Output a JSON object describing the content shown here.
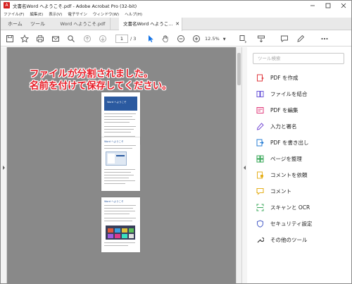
{
  "window": {
    "title": "文書名Word へようこそ.pdf - Adobe Acrobat Pro (32-bit)"
  },
  "menu": [
    "ファイル(F)",
    "編集(E)",
    "表示(V)",
    "電子サイン",
    "ウィンドウ(W)",
    "ヘルプ(H)"
  ],
  "tabs": {
    "home": "ホーム",
    "tools": "ツール"
  },
  "doc_tabs": [
    {
      "label": "Word へようこそ.pdf",
      "active": false
    },
    {
      "label": "文書名Word へようこ...",
      "active": true
    }
  ],
  "toolbar": {
    "page_current": "1",
    "page_total": "/ 3",
    "zoom": "12.5%"
  },
  "annotation": {
    "line1": "ファイルが分割されました。",
    "line2": "名前を付けて保存してください。",
    "color": "#e8202a"
  },
  "right_pane": {
    "search_placeholder": "ツール検索",
    "tools": [
      {
        "label": "PDF を作成",
        "icon": "create-pdf-icon",
        "color": "#e0393e"
      },
      {
        "label": "ファイルを結合",
        "icon": "combine-files-icon",
        "color": "#6a55d8"
      },
      {
        "label": "PDF を編集",
        "icon": "edit-pdf-icon",
        "color": "#e0397a"
      },
      {
        "label": "入力と署名",
        "icon": "fill-sign-icon",
        "color": "#7b52d6"
      },
      {
        "label": "PDF を書き出し",
        "icon": "export-pdf-icon",
        "color": "#2a7fd6"
      },
      {
        "label": "ページを整理",
        "icon": "organize-pages-icon",
        "color": "#3aa85a"
      },
      {
        "label": "コメントを依頼",
        "icon": "request-comment-icon",
        "color": "#e5b01f"
      },
      {
        "label": "コメント",
        "icon": "comment-icon",
        "color": "#e5b01f"
      },
      {
        "label": "スキャンと OCR",
        "icon": "scan-ocr-icon",
        "color": "#3aa85a"
      },
      {
        "label": "セキュリティ設定",
        "icon": "shield-icon",
        "color": "#4a5fc8"
      },
      {
        "label": "その他のツール",
        "icon": "more-tools-icon",
        "color": "#333333"
      }
    ]
  },
  "pages": {
    "p1_banner": "Word へようこそ",
    "p2_banner": "Word へようこそ",
    "p3_banner": "Word へようこそ"
  }
}
